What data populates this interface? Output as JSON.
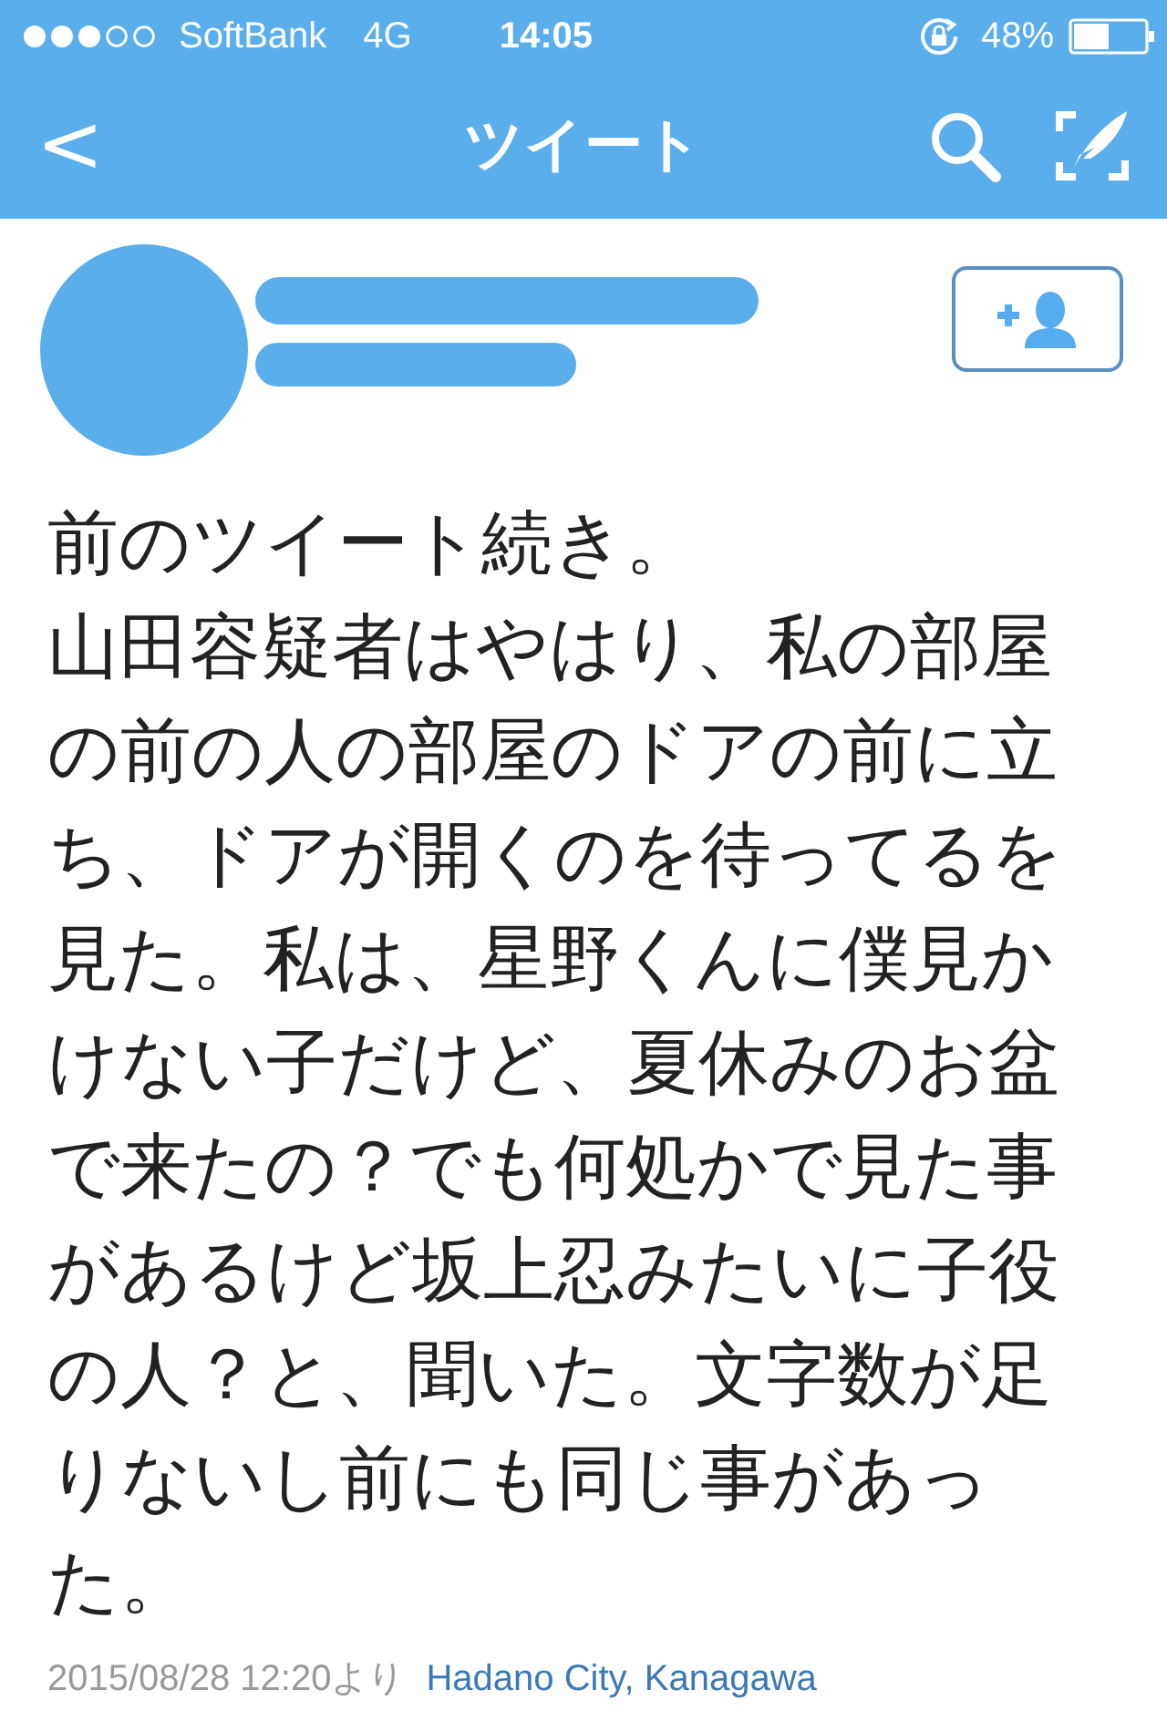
{
  "status_bar": {
    "carrier": "SoftBank",
    "network": "4G",
    "time": "14:05",
    "battery": "48%"
  },
  "nav": {
    "back": "<",
    "title": "ツイート"
  },
  "tweet": {
    "lines": [
      "前のツイート続き。",
      "山田容疑者はやはり、私の部屋の前の人の部屋のドアの前に立ち、ドアが開くのを待ってるを見た。私は、星野くんに僕見かけない子だけど、夏休みのお盆で来たの？でも何処かで見た事があるけど坂上忍みたいに子役の人？と、聞いた。文字数が足りないし前にも同じ事があった。"
    ],
    "timestamp": "2015/08/28 12:20より",
    "location": "Hadano City, Kanagawa"
  }
}
